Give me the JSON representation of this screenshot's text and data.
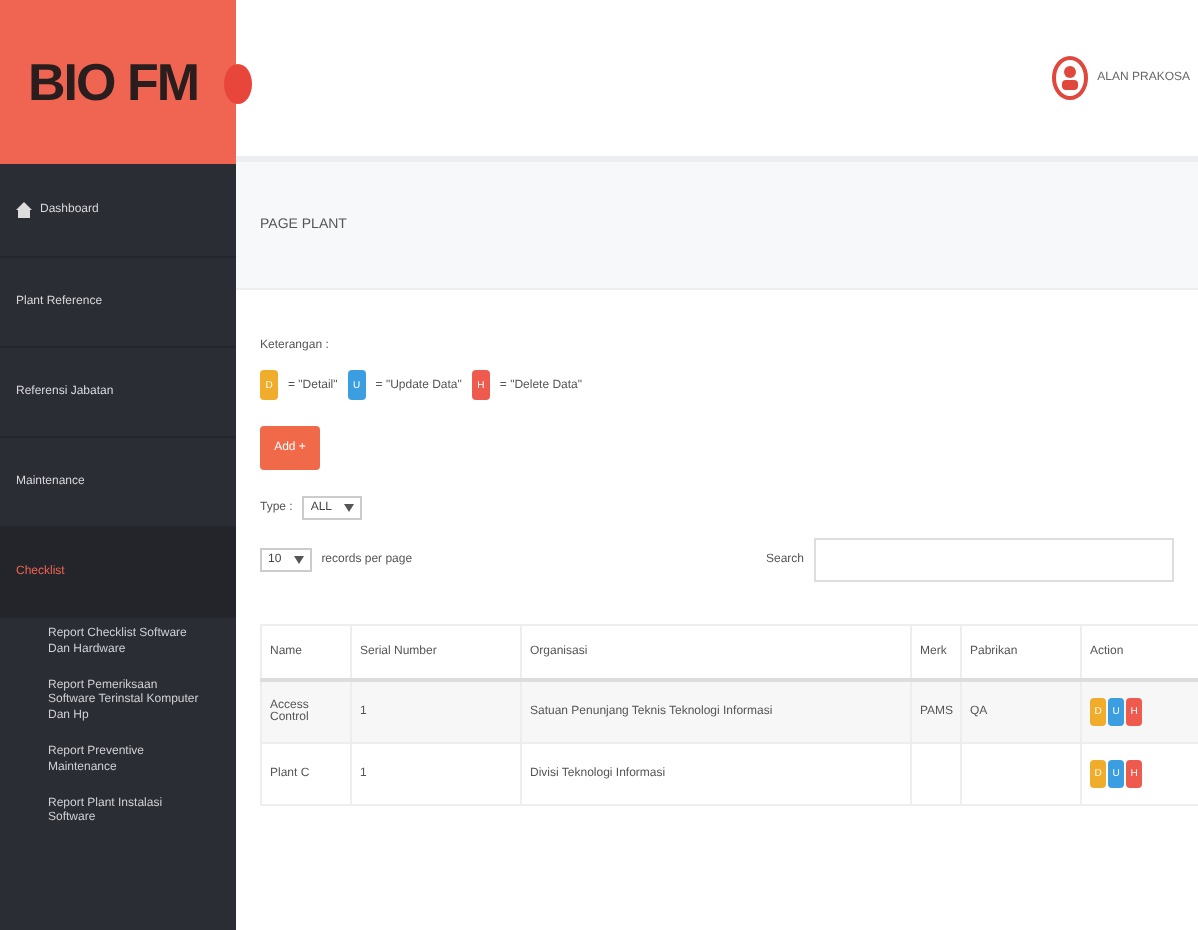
{
  "logo": "BIO FM",
  "user": {
    "name": "ALAN PRAKOSA"
  },
  "sidebar": {
    "items": [
      {
        "label": "Dashboard",
        "kind": "icon",
        "selected": false
      },
      {
        "label": "Plant Reference",
        "kind": "plain",
        "selected": false
      },
      {
        "label": "Referensi Jabatan",
        "kind": "plain",
        "selected": false
      },
      {
        "label": "Maintenance",
        "kind": "plain",
        "selected": false
      },
      {
        "label": "Checklist",
        "kind": "plain",
        "selected": true,
        "children": [
          {
            "label": "Report Checklist Software Dan Hardware"
          },
          {
            "label": "Report Pemeriksaan Software Terinstal Komputer Dan Hp"
          },
          {
            "label": "Report Preventive Maintenance"
          },
          {
            "label": "Report Plant Instalasi Software"
          }
        ]
      }
    ]
  },
  "page_title": "PAGE PLANT",
  "legend": {
    "title": "Keterangan :",
    "items": [
      {
        "key": "D",
        "text": "= \"Detail\"",
        "color": "#f0ad2c"
      },
      {
        "key": "U",
        "text": "= \"Update Data\"",
        "color": "#3b9ee0"
      },
      {
        "key": "H",
        "text": "= \"Delete Data\"",
        "color": "#ef5a4f"
      }
    ]
  },
  "add_button": "Add +",
  "type_filter": {
    "label": "Type :",
    "value": "ALL"
  },
  "page_size": {
    "value": "10",
    "label": "records per page"
  },
  "search": {
    "label": "Search"
  },
  "table": {
    "columns": [
      "Name",
      "Serial Number",
      "Organisasi",
      "Merk",
      "Pabrikan",
      "Action"
    ],
    "rows": [
      {
        "cells": [
          "Access Control",
          "1",
          "Satuan Penunjang Teknis Teknologi Informasi",
          "PAMS",
          "QA"
        ],
        "actions": [
          "D",
          "U",
          "H"
        ]
      },
      {
        "cells": [
          "Plant C",
          "1",
          "Divisi Teknologi Informasi",
          "",
          ""
        ],
        "actions": [
          "D",
          "U",
          "H"
        ]
      }
    ]
  }
}
